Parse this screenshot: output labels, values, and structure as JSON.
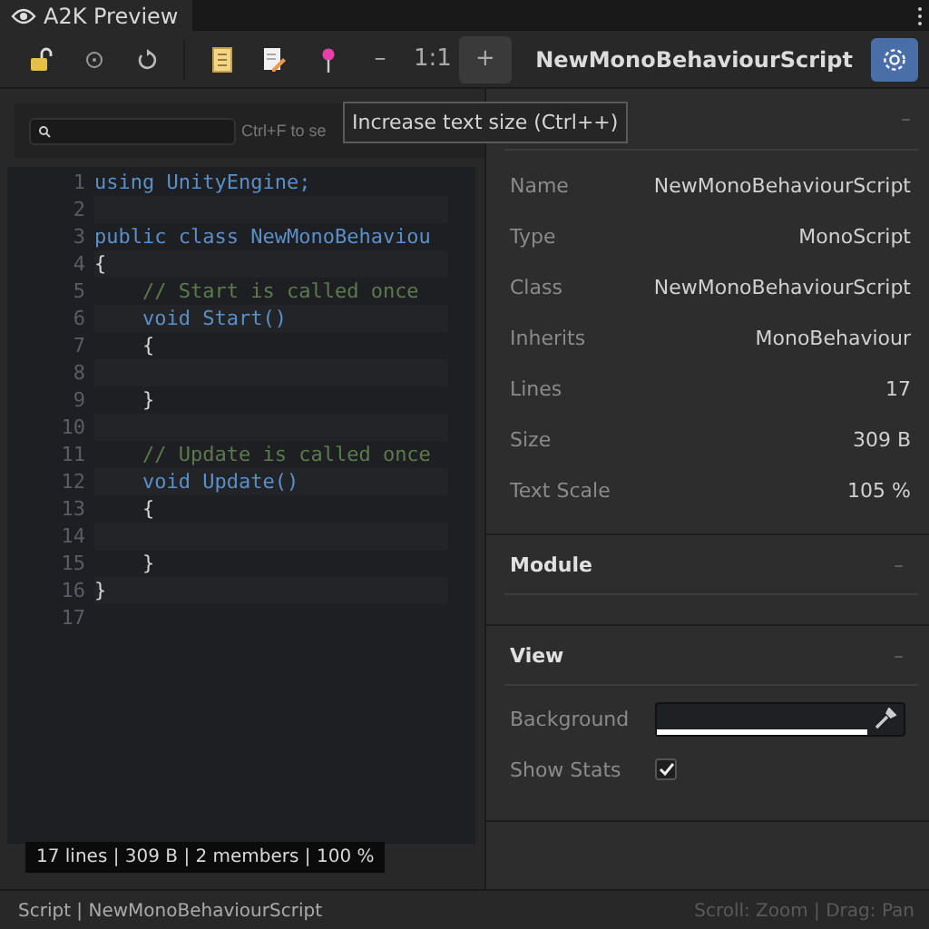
{
  "tab": {
    "label": "A2K Preview",
    "selected": true
  },
  "toolbar": {
    "items": [
      {
        "kind": "lock",
        "highlighted": false
      },
      {
        "kind": "target",
        "highlighted": false
      },
      {
        "kind": "refresh",
        "highlighted": false
      },
      {
        "kind": "divider"
      },
      {
        "kind": "document",
        "highlighted": false
      },
      {
        "kind": "edit-document",
        "highlighted": false
      },
      {
        "kind": "pin",
        "highlighted": false
      },
      {
        "kind": "text",
        "text": "–",
        "highlighted": false
      },
      {
        "kind": "text",
        "text": "1:1",
        "highlighted": false
      },
      {
        "kind": "text",
        "text": "+",
        "highlighted": true
      }
    ],
    "title": "NewMonoBehaviourScript"
  },
  "search": {
    "hint": "Ctrl+F to se"
  },
  "tooltip": "Increase text size (Ctrl++)",
  "code": {
    "lines": [
      {
        "number": "1",
        "kind": "code",
        "text": "using UnityEngine;"
      },
      {
        "number": "2"
      },
      {
        "number": "3",
        "kind": "code",
        "text": "public class NewMonoBehaviou"
      },
      {
        "number": "4",
        "kind": "plain",
        "text": "{"
      },
      {
        "number": "5",
        "kind": "comment",
        "text": "    // Start is called once"
      },
      {
        "number": "6",
        "kind": "code",
        "text": "    void Start()"
      },
      {
        "number": "7",
        "kind": "plain",
        "text": "    {"
      },
      {
        "number": "8"
      },
      {
        "number": "9",
        "kind": "plain",
        "text": "    }"
      },
      {
        "number": "10"
      },
      {
        "number": "11",
        "kind": "comment",
        "text": "    // Update is called once"
      },
      {
        "number": "12",
        "kind": "code",
        "text": "    void Update()"
      },
      {
        "number": "13",
        "kind": "plain",
        "text": "    {"
      },
      {
        "number": "14"
      },
      {
        "number": "15",
        "kind": "plain",
        "text": "    }"
      },
      {
        "number": "16",
        "kind": "plain",
        "text": "}"
      },
      {
        "number": "17"
      }
    ],
    "stats": "17 lines | 309 B | 2 members | 100 %"
  },
  "details_toggle": "–",
  "properties": [
    {
      "label": "Name",
      "value": "NewMonoBehaviourScript"
    },
    {
      "label": "Type",
      "value": "MonoScript"
    },
    {
      "label": "Class",
      "value": "NewMonoBehaviourScript"
    },
    {
      "label": "Inherits",
      "value": "MonoBehaviour"
    },
    {
      "label": "Lines",
      "value": "17"
    },
    {
      "label": "Size",
      "value": "309 B"
    },
    {
      "label": "Text Scale",
      "value": "105 %"
    }
  ],
  "sections": [
    {
      "title": "Module",
      "toggle": "–"
    },
    {
      "title": "View",
      "toggle": "–",
      "fields": [
        {
          "kind": "color",
          "label": "Background"
        },
        {
          "kind": "checkbox",
          "label": "Show Stats",
          "checked": true
        }
      ]
    }
  ],
  "status_bar": {
    "left": "Script | NewMonoBehaviourScript",
    "right": "Scroll: Zoom | Drag: Pan"
  }
}
